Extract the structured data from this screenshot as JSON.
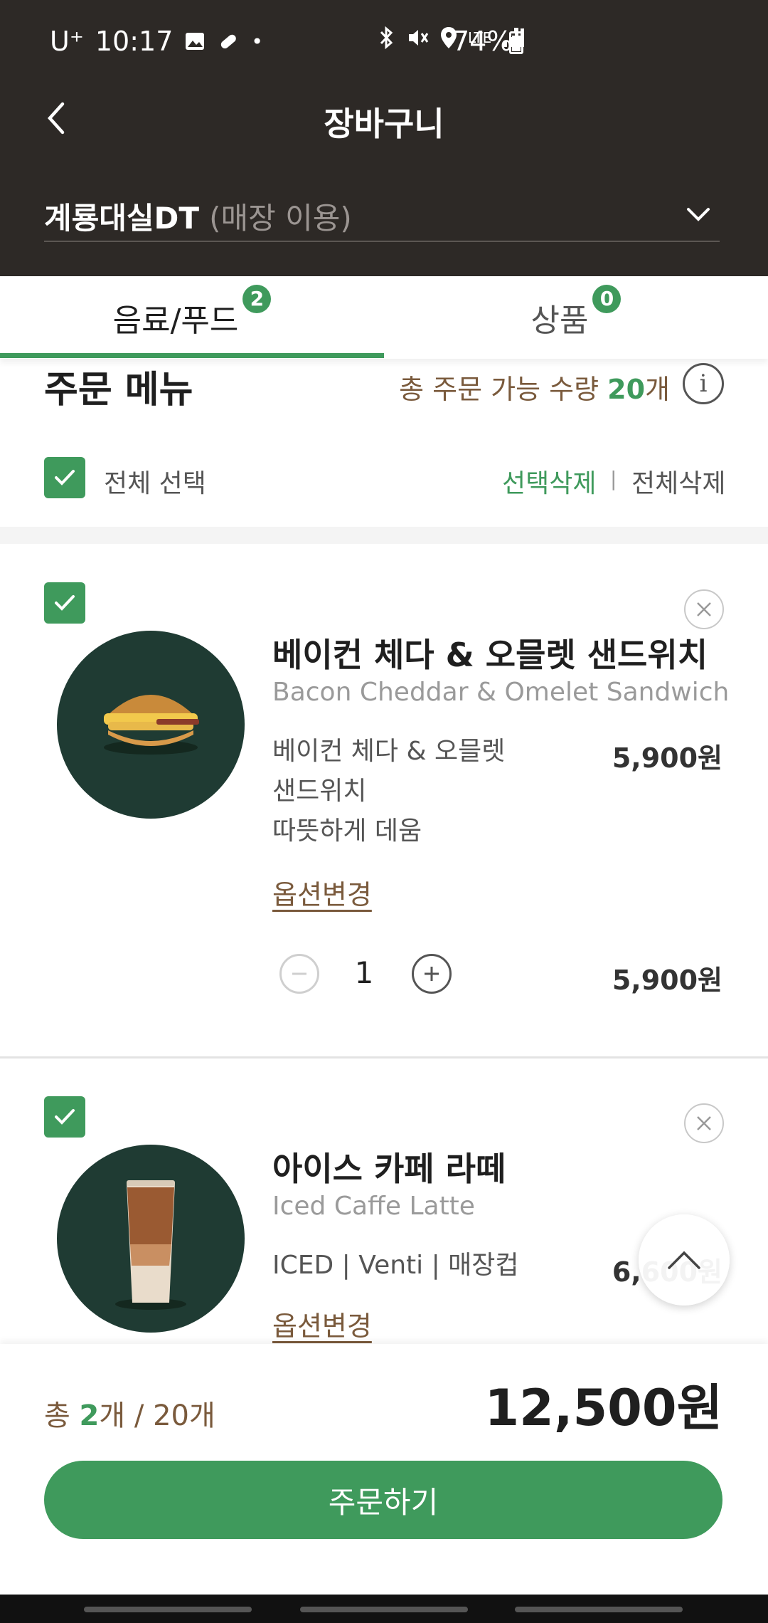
{
  "status_bar": {
    "carrier": "U⁺",
    "time": "10:17",
    "network": "LTE",
    "battery": "74%"
  },
  "header": {
    "title": "장바구니"
  },
  "store": {
    "name": "계룡대실DT",
    "mode": "(매장 이용)"
  },
  "tabs": [
    {
      "label": "음료/푸드",
      "badge": "2"
    },
    {
      "label": "상품",
      "badge": "0"
    }
  ],
  "order_section": {
    "heading": "주문 메뉴",
    "limit_prefix": "총 주문 가능 수량 ",
    "limit_count": "20",
    "limit_suffix": "개",
    "select_all": "전체 선택",
    "delete_selected": "선택삭제",
    "separator": "|",
    "delete_all": "전체삭제"
  },
  "items": [
    {
      "name": "베이컨 체다 & 오믈렛 샌드위치",
      "name_en": "Bacon Cheddar & Omelet Sandwich",
      "option_line1": "베이컨 체다 & 오믈렛",
      "option_line2": "샌드위치",
      "option_line3": "따뜻하게 데움",
      "price": "5,900원",
      "option_change": "옵션변경",
      "quantity": "1",
      "line_total": "5,900원"
    },
    {
      "name": "아이스 카페 라떼",
      "name_en": "Iced Caffe Latte",
      "option_line1": "ICED | Venti | 매장컵",
      "price": "6,600원",
      "option_change": "옵션변경"
    }
  ],
  "footer": {
    "total_prefix": "총 ",
    "total_count": "2",
    "total_suffix": "개 / 20개",
    "total_price": "12,500원",
    "order_button": "주문하기"
  },
  "colors": {
    "accent": "#3f9a5c",
    "header_bg": "#2d2926",
    "brown_text": "#7a5a3c"
  }
}
